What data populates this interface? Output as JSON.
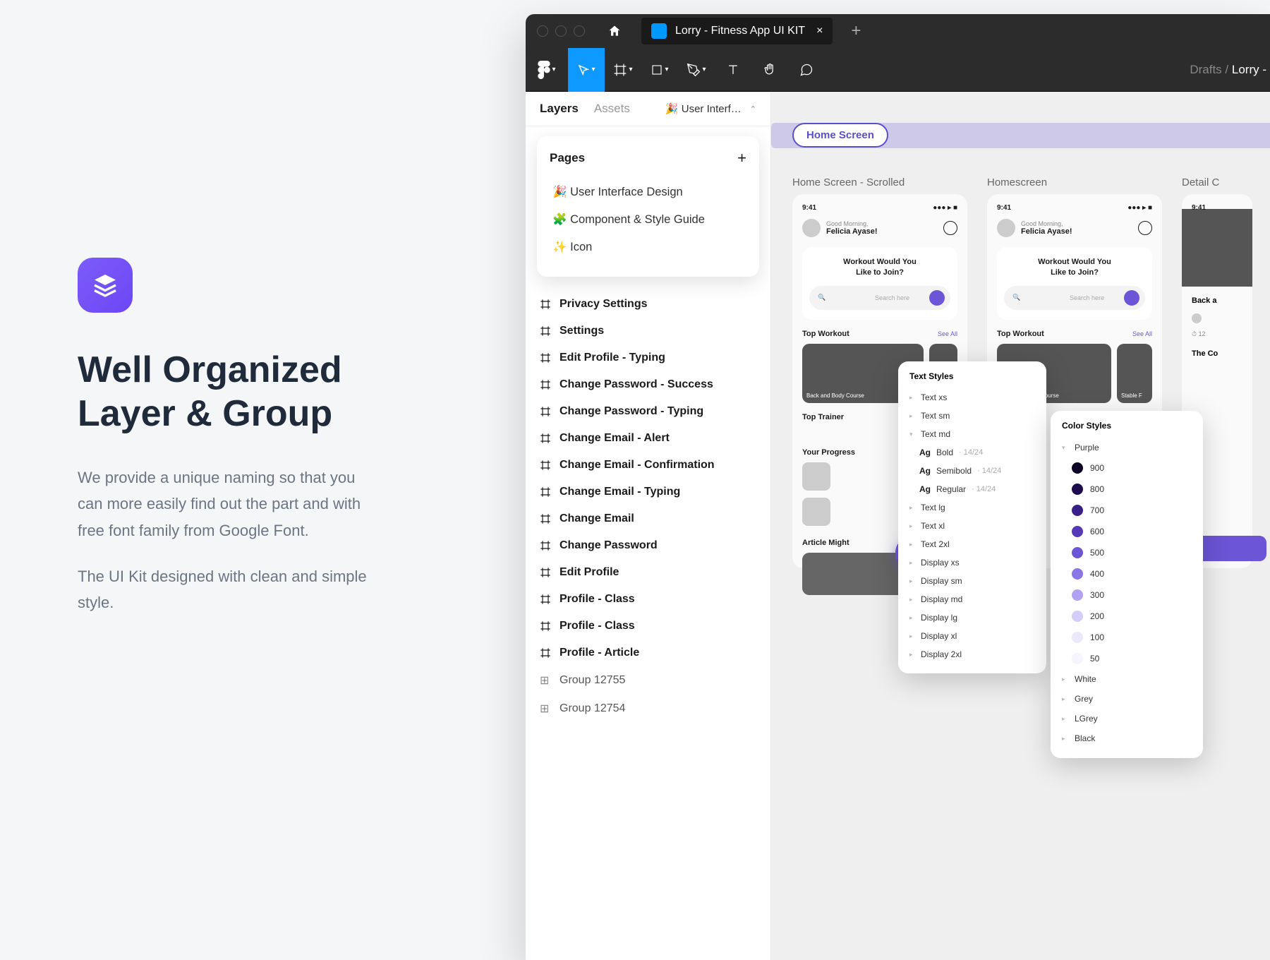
{
  "promo": {
    "title_l1": "Well Organized",
    "title_l2": "Layer & Group",
    "p1": "We provide a unique naming so that you can more easily find out the part and with free font family from Google Font.",
    "p2": "The UI Kit designed with clean and simple style."
  },
  "titlebar": {
    "tab_name": "Lorry - Fitness App UI KIT",
    "close": "×",
    "plus": "+"
  },
  "crumb": {
    "root": "Drafts",
    "sep": "/",
    "file": "Lorry - "
  },
  "panel": {
    "tab_layers": "Layers",
    "tab_assets": "Assets",
    "page_sel": "🎉 User Interf…"
  },
  "pages": {
    "title": "Pages",
    "items": [
      "🎉 User Interface Design",
      "🧩 Component & Style Guide",
      "✨ Icon"
    ]
  },
  "frames": [
    "Privacy Settings",
    "Settings",
    "Edit Profile - Typing",
    "Change Password - Success",
    "Change Password - Typing",
    "Change Email - Alert",
    "Change Email - Confirmation",
    "Change Email - Typing",
    "Change Email",
    "Change Password",
    "Edit Profile",
    "Profile - Class",
    "Profile - Class",
    "Profile - Article"
  ],
  "groups": [
    "Group 12755",
    "Group 12754"
  ],
  "canvas": {
    "pill": "Home Screen",
    "ab1_title": "Home Screen - Scrolled",
    "ab2_title": "Homescreen",
    "ab3_title": "Detail C",
    "time": "9:41",
    "greeting": "Good Morning,",
    "username": "Felicia Ayase!",
    "hero_l1": "Workout Would You",
    "hero_l2": "Like to Join?",
    "search_ph": "Search here",
    "sec_workout": "Top Workout",
    "sec_trainer": "Top Trainer",
    "sec_progress": "Your Progress",
    "sec_article": "Article Might",
    "see_all": "See All",
    "card1": "Back and Body Course",
    "card2": "Stable F",
    "back_a": "Back a",
    "the_co": "The Co"
  },
  "text_styles": {
    "title": "Text Styles",
    "groups": [
      "Text xs",
      "Text sm",
      "Text md"
    ],
    "md_items": [
      {
        "w": "Bold",
        "s": "14/24"
      },
      {
        "w": "Semibold",
        "s": "14/24"
      },
      {
        "w": "Regular",
        "s": "14/24"
      }
    ],
    "rest": [
      "Text lg",
      "Text xl",
      "Text 2xl",
      "Display xs",
      "Display sm",
      "Display md",
      "Display lg",
      "Display xl",
      "Display 2xl"
    ]
  },
  "color_styles": {
    "title": "Color Styles",
    "group": "Purple",
    "shades": [
      {
        "n": "900",
        "c": "#0d0226"
      },
      {
        "n": "800",
        "c": "#1e0a4f"
      },
      {
        "n": "700",
        "c": "#3a1f87"
      },
      {
        "n": "600",
        "c": "#5438b8"
      },
      {
        "n": "500",
        "c": "#6c55d6"
      },
      {
        "n": "400",
        "c": "#8b76e8"
      },
      {
        "n": "300",
        "c": "#b0a1f2"
      },
      {
        "n": "200",
        "c": "#d4cdf9"
      },
      {
        "n": "100",
        "c": "#ece8fc"
      },
      {
        "n": "50",
        "c": "#f6f4fe"
      }
    ],
    "others": [
      "White",
      "Grey",
      "LGrey",
      "Black"
    ]
  }
}
